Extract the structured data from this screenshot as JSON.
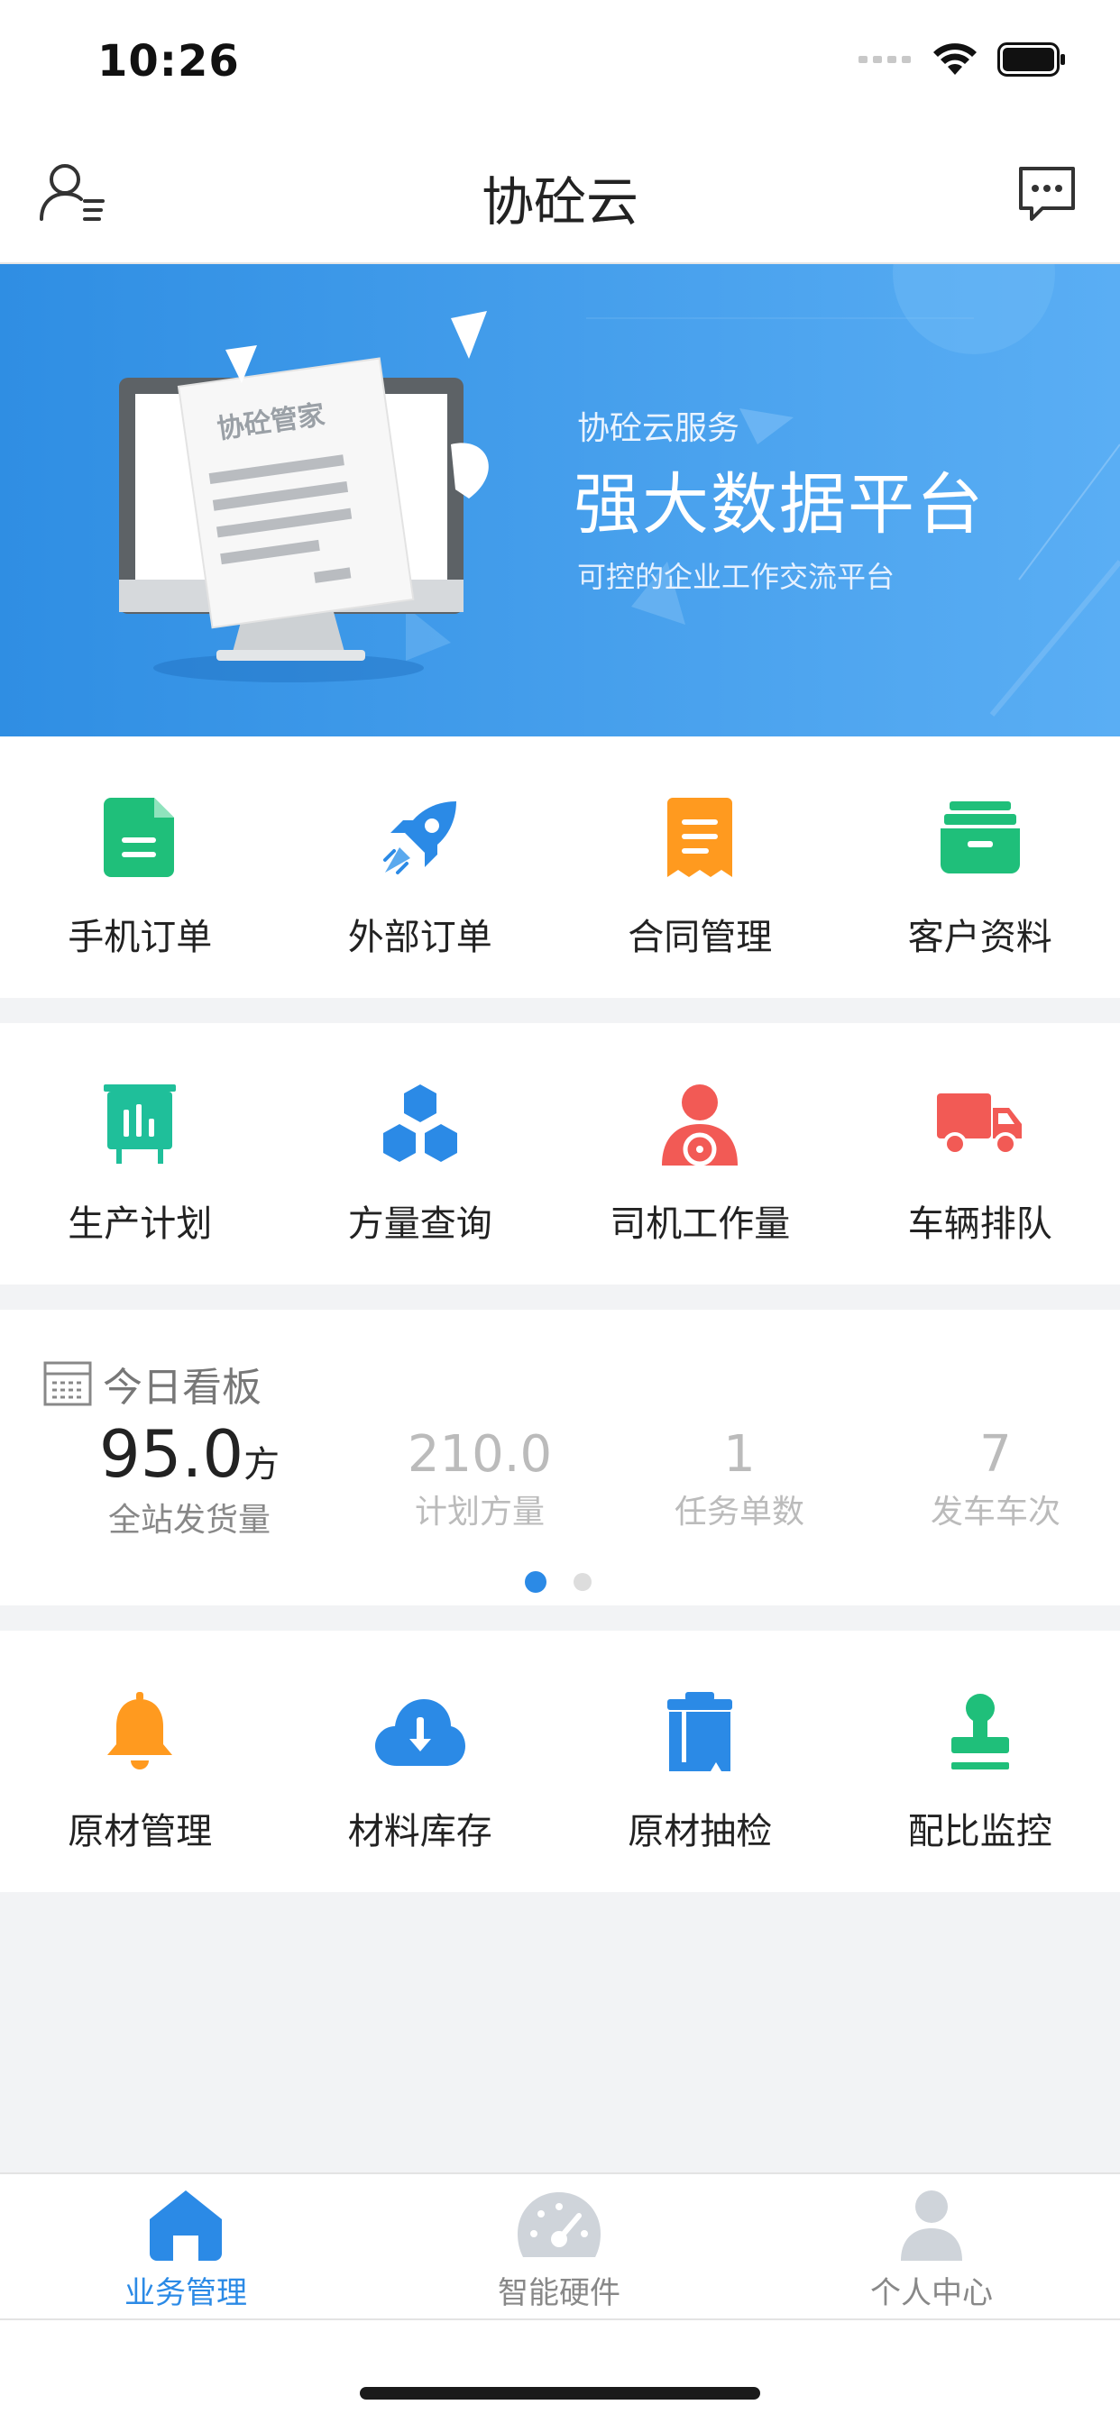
{
  "status": {
    "time": "10:26"
  },
  "nav": {
    "title": "协砼云"
  },
  "banner": {
    "doc_label": "协砼管家",
    "subtitle": "协砼云服务",
    "title": "强大数据平台",
    "description": "可控的企业工作交流平台"
  },
  "menu_group_1": [
    {
      "label": "手机订单",
      "icon": "document-icon",
      "color": "#1fbf7a"
    },
    {
      "label": "外部订单",
      "icon": "rocket-icon",
      "color": "#2b8ae6"
    },
    {
      "label": "合同管理",
      "icon": "receipt-icon",
      "color": "#ff9a1f"
    },
    {
      "label": "客户资料",
      "icon": "archive-box-icon",
      "color": "#1fbf7a"
    }
  ],
  "menu_group_2": [
    {
      "label": "生产计划",
      "icon": "plan-board-icon",
      "color": "#1fbf9a"
    },
    {
      "label": "方量查询",
      "icon": "hexagons-icon",
      "color": "#2b8ae6"
    },
    {
      "label": "司机工作量",
      "icon": "driver-icon",
      "color": "#f25a55"
    },
    {
      "label": "车辆排队",
      "icon": "truck-icon",
      "color": "#f25a55"
    }
  ],
  "dashboard": {
    "title": "今日看板",
    "stats": [
      {
        "value": "95.0",
        "unit": "方",
        "label": "全站发货量"
      },
      {
        "value": "210.0",
        "label": "计划方量"
      },
      {
        "value": "1",
        "label": "任务单数"
      },
      {
        "value": "7",
        "label": "发车车次"
      }
    ],
    "page_index": 0,
    "page_count": 2
  },
  "menu_group_3": [
    {
      "label": "原材管理",
      "icon": "bell-icon",
      "color": "#ff9a1f"
    },
    {
      "label": "材料库存",
      "icon": "cloud-download-icon",
      "color": "#2b8ae6"
    },
    {
      "label": "原材抽检",
      "icon": "clipboard-icon",
      "color": "#2b8ae6"
    },
    {
      "label": "配比监控",
      "icon": "stamp-icon",
      "color": "#1fbf7a"
    }
  ],
  "tabbar": [
    {
      "label": "业务管理",
      "icon": "home-icon",
      "active": true
    },
    {
      "label": "智能硬件",
      "icon": "gauge-icon",
      "active": false
    },
    {
      "label": "个人中心",
      "icon": "person-icon",
      "active": false
    }
  ],
  "colors": {
    "accent": "#2b8ae6",
    "banner_from": "#2f8ee3",
    "banner_to": "#62b1f5"
  }
}
